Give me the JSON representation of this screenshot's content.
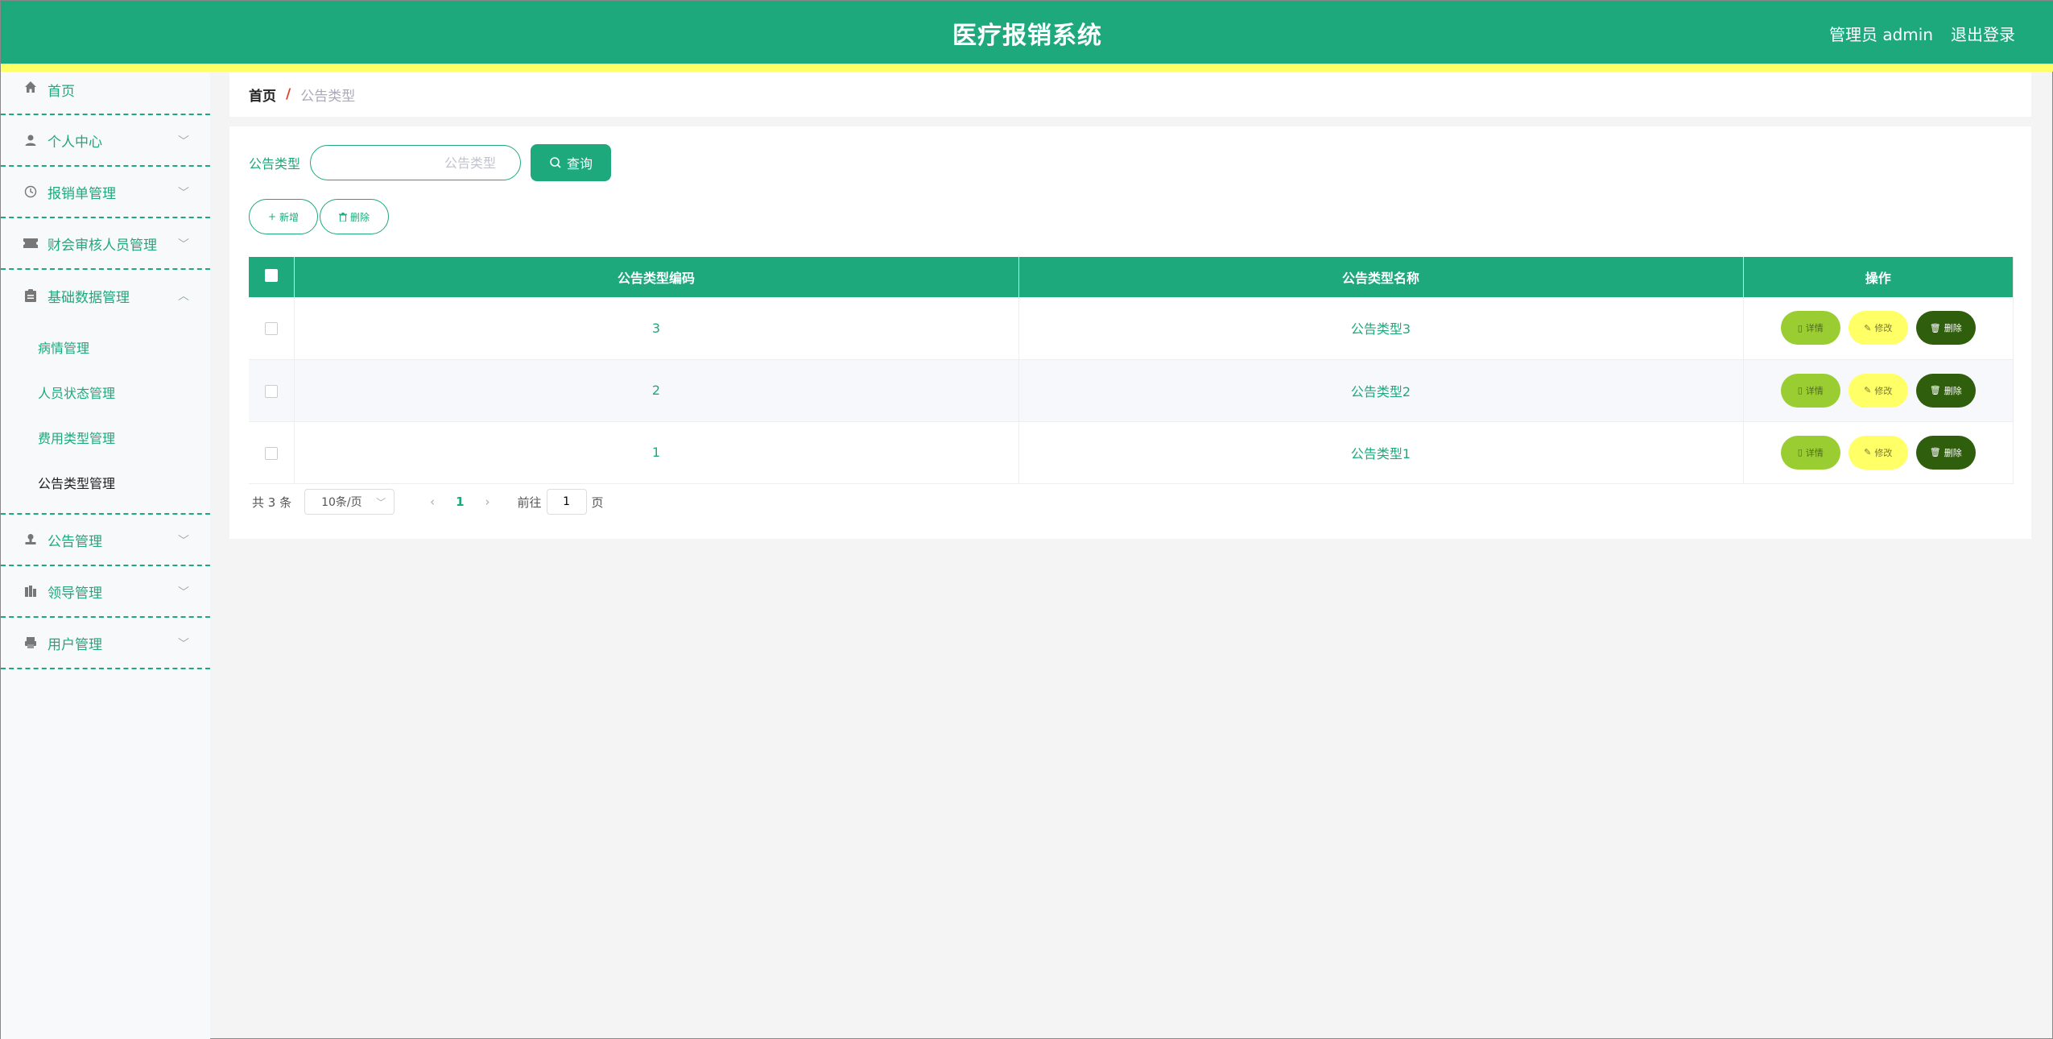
{
  "header": {
    "title": "医疗报销系统",
    "user": "管理员 admin",
    "logout": "退出登录"
  },
  "sidebar": {
    "items": [
      {
        "label": "首页",
        "icon": "home-icon"
      },
      {
        "label": "个人中心",
        "icon": "user-icon"
      },
      {
        "label": "报销单管理",
        "icon": "clock-icon"
      },
      {
        "label": "财会审核人员管理",
        "icon": "ticket-icon"
      },
      {
        "label": "基础数据管理",
        "icon": "clipboard-icon"
      },
      {
        "label": "公告管理",
        "icon": "stamp-icon"
      },
      {
        "label": "领导管理",
        "icon": "office-icon"
      },
      {
        "label": "用户管理",
        "icon": "printer-icon"
      }
    ],
    "submenu": [
      "病情管理",
      "人员状态管理",
      "费用类型管理",
      "公告类型管理"
    ]
  },
  "breadcrumb": {
    "home": "首页",
    "sep": "/",
    "current": "公告类型"
  },
  "search": {
    "label": "公告类型",
    "placeholder": "公告类型",
    "button": "查询"
  },
  "actions": {
    "add": "新增",
    "delete": "删除"
  },
  "table": {
    "headers": [
      "公告类型编码",
      "公告类型名称",
      "操作"
    ],
    "rows": [
      {
        "code": "3",
        "name": "公告类型3"
      },
      {
        "code": "2",
        "name": "公告类型2"
      },
      {
        "code": "1",
        "name": "公告类型1"
      }
    ],
    "ops": {
      "detail": "详情",
      "edit": "修改",
      "delete": "删除"
    }
  },
  "pager": {
    "total": "共 3 条",
    "size": "10条/页",
    "page": "1",
    "goto": "前往",
    "jump": "1",
    "unit": "页"
  },
  "colors": {
    "primary": "#1ea97c",
    "stripe": "#ffff66",
    "detail": "#9acd32",
    "edit": "#ffff66",
    "delete": "#2f5e0c"
  }
}
